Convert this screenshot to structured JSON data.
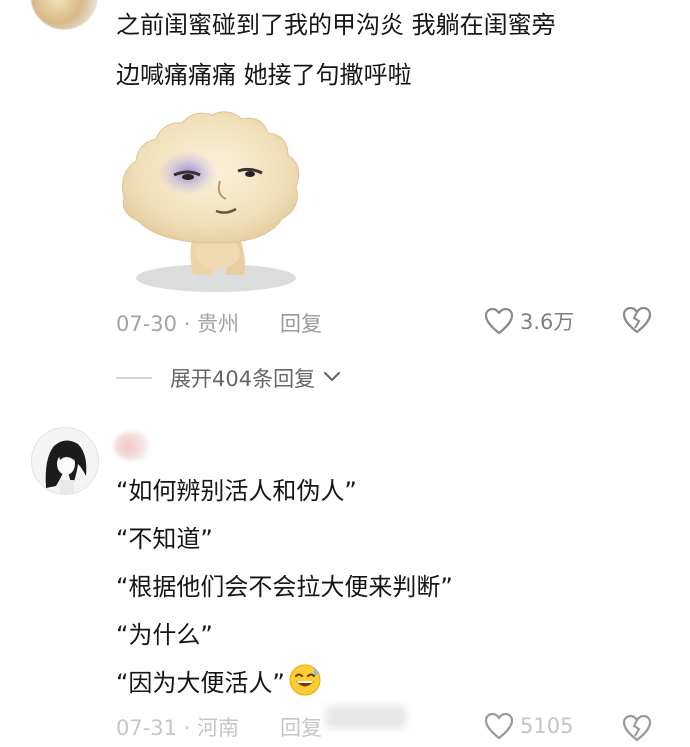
{
  "comment1": {
    "lines": [
      "之前闺蜜碰到了我的甲沟炎 我躺在闺蜜旁",
      "边喊痛痛痛 她接了句撒呼啦"
    ],
    "date": "07-30 · 贵州",
    "reply_label": "回复",
    "like_count": "3.6万",
    "expand_label": "展开404条回复"
  },
  "comment2": {
    "lines": [
      "“如何辨别活人和伪人”",
      "“不知道”",
      "“根据他们会不会拉大便来判断”",
      "“为什么”",
      "“因为大便活人”"
    ],
    "date": "07-31 · 河南",
    "reply_label": "回复",
    "like_count": "5105"
  },
  "icons": {
    "like": "heart-outline-icon",
    "dislike": "broken-heart-icon",
    "expand": "chevron-down-icon",
    "emoji": "grinning-sweat-emoji"
  },
  "colors": {
    "text": "#161616",
    "meta": "#a3a3a3",
    "icon": "#8a8a8a"
  }
}
